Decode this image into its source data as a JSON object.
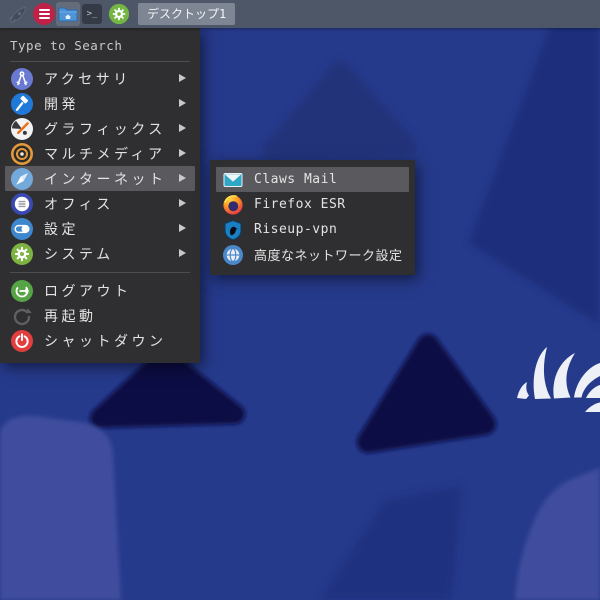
{
  "panel": {
    "workspace_label": "デスクトップ1",
    "terminal_glyph": ">_"
  },
  "menu": {
    "search_hint": "Type to Search",
    "categories": [
      {
        "label": "アクセサリ"
      },
      {
        "label": "開発"
      },
      {
        "label": "グラフィックス"
      },
      {
        "label": "マルチメディア"
      },
      {
        "label": "インターネット",
        "highlighted": true
      },
      {
        "label": "オフィス"
      },
      {
        "label": "設定"
      },
      {
        "label": "システム"
      }
    ],
    "session": [
      {
        "label": "ログアウト"
      },
      {
        "label": "再起動",
        "disabled": true
      },
      {
        "label": "シャットダウン"
      }
    ]
  },
  "submenu": {
    "items": [
      {
        "label": "Claws Mail",
        "highlighted": true
      },
      {
        "label": "Firefox ESR"
      },
      {
        "label": "Riseup-vpn"
      },
      {
        "label": "高度なネットワーク設定"
      }
    ]
  },
  "colors": {
    "wallpaper_base": "#263a8c",
    "wallpaper_dark_right": "#1f2e7c",
    "wallpaper_dark_triangle": "#070d45",
    "wallpaper_light_shape": "#404d9e",
    "panel_bg": "#4e5767",
    "menu_bg": "#2f2f31",
    "menu_highlight": "#5a5a5e",
    "menu_button_red": "#bf2246",
    "pager_bg": "#7e8694",
    "logo_white": "#edf0f6"
  }
}
